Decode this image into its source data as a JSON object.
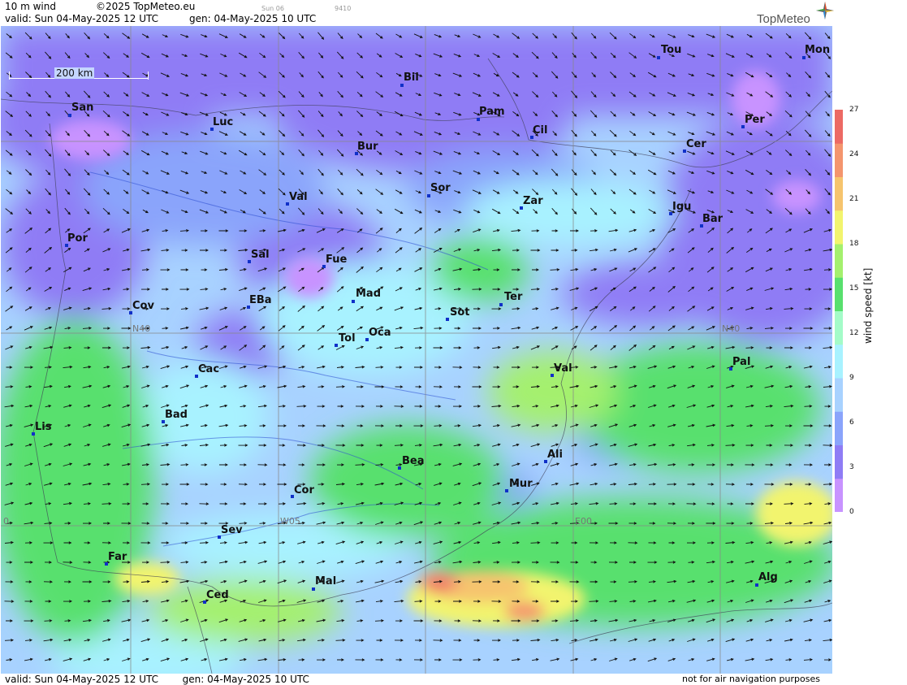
{
  "header": {
    "product": "10 m wind",
    "copyright": "©2025 TopMeteo.eu",
    "day_short": "Sun 06",
    "code": "9410",
    "valid": "valid:  Sun  04-May-2025  12 UTC",
    "generated": "gen: 04-May-2025 10 UTC",
    "logo": "TopMeteo"
  },
  "scale_bar": {
    "label": "200 km"
  },
  "grid_labels": [
    "N40",
    "N40",
    "W05",
    "E00",
    "0"
  ],
  "cities": [
    "San",
    "Luc",
    "Bil",
    "Pam",
    "Cil",
    "Bur",
    "Tou",
    "Mon",
    "Per",
    "Cer",
    "Val",
    "Sor",
    "Zar",
    "Igu",
    "Bar",
    "Por",
    "Sal",
    "Fue",
    "Cov",
    "EBa",
    "Mad",
    "Sot",
    "Ter",
    "Tol",
    "Oca",
    "Pal",
    "Cac",
    "Val",
    "Lis",
    "Bad",
    "Bea",
    "Ali",
    "Mur",
    "Cor",
    "Sev",
    "Far",
    "Mal",
    "Ced",
    "Alg"
  ],
  "legend": {
    "title": "wind speed [kt]",
    "ticks": [
      "27",
      "24",
      "21",
      "18",
      "15",
      "12",
      "9",
      "6",
      "3",
      "0"
    ],
    "colors": [
      "#c893ff",
      "#8f7cf5",
      "#8aa4fb",
      "#a8d2ff",
      "#a8f2ff",
      "#a4fbc8",
      "#58e06e",
      "#a4f06e",
      "#f2f46e",
      "#f6c46e",
      "#f4956e",
      "#ec6a64"
    ]
  },
  "footer": {
    "valid": "valid:  Sun  04-May-2025  12 UTC",
    "generated": "gen: 04-May-2025 10 UTC",
    "note": "not for air navigation purposes"
  }
}
